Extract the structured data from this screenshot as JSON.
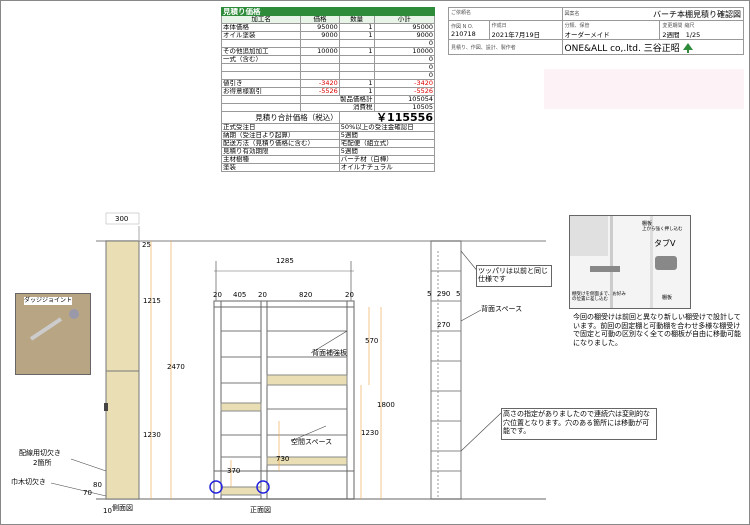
{
  "estimate": {
    "title": "見積り価格",
    "col_headers": [
      "加工名",
      "価格",
      "数量",
      "小計"
    ],
    "rows": [
      {
        "name": "本体価格",
        "price": "95000",
        "qty": "1",
        "sub": "95000"
      },
      {
        "name": "オイル塗装",
        "price": "9000",
        "qty": "1",
        "sub": "9000"
      },
      {
        "name": "",
        "price": "",
        "qty": "",
        "sub": "0"
      },
      {
        "name": "その他追加加工",
        "price": "10000",
        "qty": "1",
        "sub": "10000"
      },
      {
        "name": "一式（含む）",
        "price": "",
        "qty": "",
        "sub": "0"
      },
      {
        "name": "",
        "price": "",
        "qty": "",
        "sub": "0"
      },
      {
        "name": "",
        "price": "",
        "qty": "",
        "sub": "0"
      },
      {
        "name": "値引き",
        "price": "-3420",
        "qty": "1",
        "sub": "-3420"
      },
      {
        "name": "お得意様割引",
        "price": "-5526",
        "qty": "1",
        "sub": "-5526"
      }
    ],
    "product_total_label": "製品価格計",
    "product_total": "105054",
    "tax_label": "消費税",
    "tax": "10505",
    "grand_label": "見積り合計価格（税込）",
    "grand_total": "￥115556",
    "info": [
      {
        "k": "正式受注日",
        "v": "50%以上の受注金確認日"
      },
      {
        "k": "納期（受注日より起算）",
        "v": "5週間"
      },
      {
        "k": "配送方法（見積り価格に含む）",
        "v": "宅配便（組立式）"
      },
      {
        "k": "見積り有効期限",
        "v": "5週間"
      },
      {
        "k": "主材樹種",
        "v": "バーチ材（白樺）"
      },
      {
        "k": "塗装",
        "v": "オイルナチュラル"
      }
    ]
  },
  "titleblock": {
    "customer_label": "ご依頼名",
    "drawing_label": "図案名",
    "drawing_name": "バーチ本棚見積り確認図",
    "order_label": "作図 N O.",
    "date_label": "作成日",
    "category_label": "分類、保管",
    "change_label": "変更期間",
    "scale_label": "縮尺",
    "order_no": "210718",
    "date": "2021年7月19日",
    "category": "オーダーメイド",
    "period": "2週間",
    "scale": "1/25",
    "maker_label": "見積り、作図、設計、製作者",
    "maker": "ONE&ALL co,.ltd. 三谷正昭"
  },
  "side": {
    "depth": "300",
    "d1215": "1215",
    "d2470": "2470",
    "d1230": "1230",
    "d25": "25",
    "d80": "80",
    "d70": "70",
    "d10": "10",
    "label": "側面図",
    "joint_label": "ダッジジョイント",
    "notch_label": "配線用切欠き",
    "notch_count": "2箇所",
    "baseboard_label": "巾木切欠き"
  },
  "front": {
    "total_w": "1285",
    "w20a": "20",
    "w405": "405",
    "w20b": "20",
    "w820": "820",
    "w20c": "20",
    "h570": "570",
    "h1800": "1800",
    "h1230": "1230",
    "h370": "370",
    "h730": "730",
    "backboard_label": "背面補強板",
    "space_label": "空間スペース",
    "label": "正面図"
  },
  "section": {
    "w5a": "5",
    "w290": "290",
    "w5b": "5",
    "w270": "270",
    "tension_note": "ツッパリは以前と同じ仕様です",
    "back_space": "背面スペース"
  },
  "shelf_notes": {
    "tab_label": "タブV",
    "shelf_label": "棚板",
    "push_label": "上から強く押し込む",
    "shelf_label2": "棚板",
    "photo_note": "棚受けを側面まで、お好みの位置に差し込む",
    "note": "今回の棚受けは前回と異なり新しい棚受けで設計しています。前回の固定棚と可動棚を合わせ多様な棚受けで固定と可動の区別なく全ての棚板が自由に移動可能になりました。",
    "height_note": "高さの指定がありましたので連続穴は変則的な穴位置となります。穴のある箇所には移動が可能です。"
  },
  "colors": {
    "accent_green": "#2e8b3a",
    "red": "#dd0000",
    "circle_blue": "#2222dd",
    "wood": "#eadfb4"
  }
}
